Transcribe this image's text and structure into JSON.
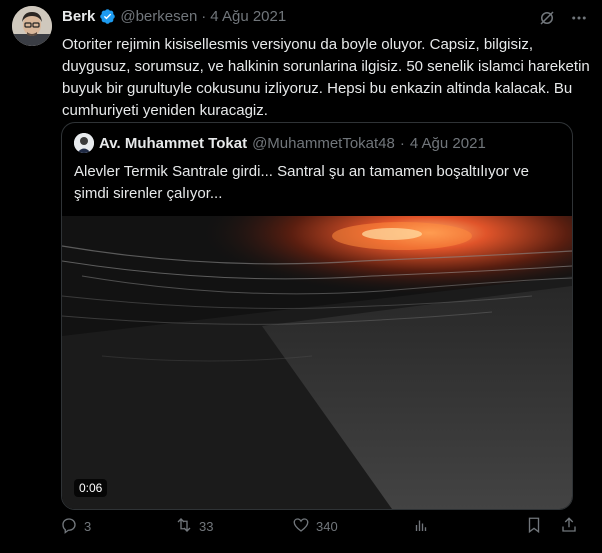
{
  "tweet": {
    "author_name": "Berk",
    "author_handle": "@berkesen",
    "separator": "·",
    "date": "4 Ağu 2021",
    "text": "Otoriter rejimin kisisellesmis versiyonu da boyle oluyor. Capsiz, bilgisiz, duygusuz, sorumsuz, ve halkinin sorunlarina ilgisiz. 50 senelik islamci hareketin buyuk bir gurultuyle cokusunu izliyoruz. Hepsi bu enkazin altinda kalacak. Bu cumhuriyeti yeniden kuracagiz."
  },
  "quote": {
    "author_name": "Av. Muhammet Tokat",
    "author_handle": "@MuhammetTokat48",
    "separator": "·",
    "date": "4 Ağu 2021",
    "text": "Alevler Termik Santrale girdi... Santral şu an tamamen boşaltılıyor ve şimdi sirenler çalıyor...",
    "video_duration": "0:06"
  },
  "actions": {
    "replies": "3",
    "retweets": "33",
    "likes": "340"
  },
  "icons": {
    "verified": "verified-badge-icon",
    "grok": "grok-icon",
    "more": "more-icon",
    "reply": "reply-icon",
    "retweet": "retweet-icon",
    "like": "heart-icon",
    "bookmark": "bookmark-icon",
    "share": "share-icon"
  },
  "colors": {
    "background": "#000000",
    "text": "#e7e9ea",
    "muted": "#71767b",
    "border": "#2f3336",
    "verified": "#1d9bf0"
  }
}
